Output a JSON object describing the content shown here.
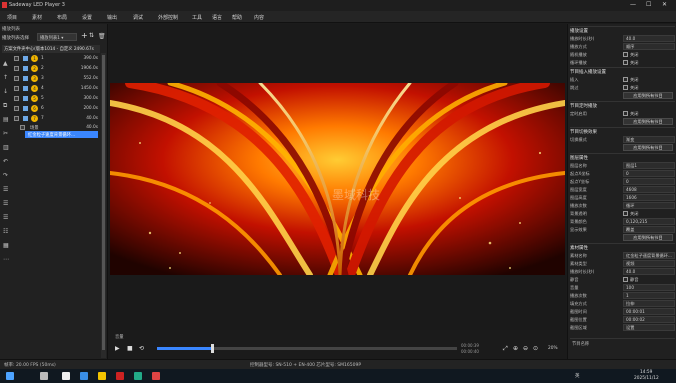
{
  "app": {
    "title": "Sadeway LED Player 3"
  },
  "menu": [
    "项目",
    "素材",
    "布局",
    "设置",
    "输出",
    "调试",
    "外部控制",
    "工具",
    "语言",
    "帮助",
    "内容"
  ],
  "left": {
    "header": "播放列表",
    "program_label": "播放列表选择",
    "program_select": "播放列表1",
    "program_title": "方案文件夹中心(版本1014 - 自定义 2490.67s",
    "tracks": [
      {
        "num": "1",
        "label": "1",
        "dur": "390.0s"
      },
      {
        "num": "2",
        "label": "2",
        "dur": "1906.0s"
      },
      {
        "num": "3",
        "label": "3",
        "dur": "552.0s"
      },
      {
        "num": "4",
        "label": "4",
        "dur": "1450.0s"
      },
      {
        "num": "5",
        "label": "5",
        "dur": "300.0s"
      },
      {
        "num": "6",
        "label": "6",
        "dur": "200.0s"
      },
      {
        "num": "7",
        "label": "7",
        "dur": "40.0s"
      }
    ],
    "group_row": {
      "label": "场景",
      "dur": "40.0s"
    },
    "selected_item": "红金粒子速度背景循环..."
  },
  "preview": {
    "watermark": "墨域科技",
    "time_left": "00:00:39",
    "time_right": "00:00:40",
    "progress_pct": 18,
    "zoom": "20%",
    "info_left": "音量"
  },
  "right": {
    "rows": [
      {
        "type": "sec",
        "k": "播放设置"
      },
      {
        "type": "val",
        "k": "播放时长(秒)",
        "v": "40.0"
      },
      {
        "type": "val",
        "k": "播放方式",
        "v": "顺序"
      },
      {
        "type": "cb",
        "k": "随机播放",
        "v": "关闭"
      },
      {
        "type": "cb",
        "k": "循环播放",
        "v": "关闭"
      },
      {
        "type": "sec",
        "k": "节目插入播放设置"
      },
      {
        "type": "cb",
        "k": "插入",
        "v": "关闭"
      },
      {
        "type": "cb",
        "k": "跳过",
        "v": "关闭"
      },
      {
        "type": "btn",
        "k": "应用到所有节目"
      },
      {
        "type": "sec",
        "k": "节目定时播放"
      },
      {
        "type": "cb",
        "k": "定时启用",
        "v": "关闭"
      },
      {
        "type": "btn",
        "k": "应用到所有节目"
      },
      {
        "type": "sec",
        "k": "节目切换效果"
      },
      {
        "type": "val",
        "k": "切换模式",
        "v": "渐变"
      },
      {
        "type": "btn",
        "k": "应用到所有节目"
      },
      {
        "type": "sec",
        "k": "图层属性"
      },
      {
        "type": "val",
        "k": "图层名称",
        "v": "图层1"
      },
      {
        "type": "val",
        "k": "起点X坐标",
        "v": "0"
      },
      {
        "type": "val",
        "k": "起点Y坐标",
        "v": "0"
      },
      {
        "type": "val",
        "k": "图层宽度",
        "v": "4608"
      },
      {
        "type": "val",
        "k": "图层高度",
        "v": "1606"
      },
      {
        "type": "val",
        "k": "播放次数",
        "v": "循环"
      },
      {
        "type": "cb",
        "k": "背景透明",
        "v": "关闭"
      },
      {
        "type": "val",
        "k": "背景颜色",
        "v": "0,120,215"
      },
      {
        "type": "val",
        "k": "显示效果",
        "v": "覆盖"
      },
      {
        "type": "btn",
        "k": "应用到所有节目"
      },
      {
        "type": "sec",
        "k": "素材属性"
      },
      {
        "type": "val",
        "k": "素材名称",
        "v": "红金粒子速度背景循环..."
      },
      {
        "type": "val",
        "k": "素材类型",
        "v": "视频"
      },
      {
        "type": "val",
        "k": "播放时长(秒)",
        "v": "40.0"
      },
      {
        "type": "cb",
        "k": "静音",
        "v": "静音"
      },
      {
        "type": "val",
        "k": "音量",
        "v": "100"
      },
      {
        "type": "val",
        "k": "播放次数",
        "v": "1"
      },
      {
        "type": "val",
        "k": "填充方式",
        "v": "拉伸"
      },
      {
        "type": "val",
        "k": "截图时间",
        "v": "00:00:01"
      },
      {
        "type": "val",
        "k": "截图位置",
        "v": "00:00:02"
      },
      {
        "type": "val",
        "k": "截图区域",
        "v": "设置"
      }
    ],
    "bottom_label": "节目名称"
  },
  "status": {
    "fps": "帧率: 20.00 FPS (50ms)",
    "chip": "控制器型号: SN-510 + EN-400  芯片型号: SM16509P"
  },
  "taskbar": {
    "time": "14:59",
    "date": "2025/11/12",
    "lang": "英"
  },
  "colors": {
    "accent": "#3a86ff",
    "badge": "#f0b400"
  }
}
